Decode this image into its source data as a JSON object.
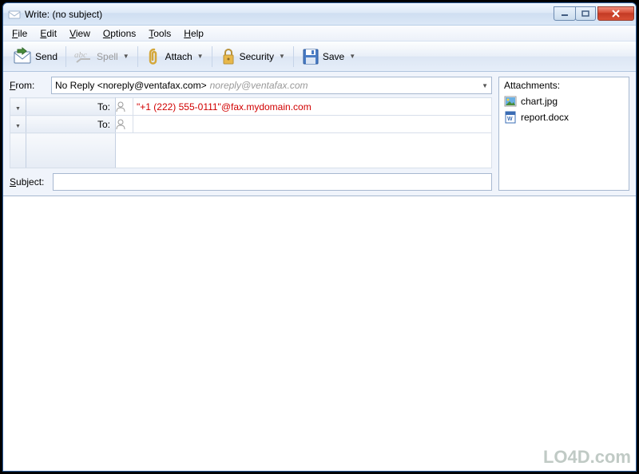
{
  "window": {
    "title": "Write: (no subject)"
  },
  "menu": {
    "file": "File",
    "edit": "Edit",
    "view": "View",
    "options": "Options",
    "tools": "Tools",
    "help": "Help"
  },
  "toolbar": {
    "send": "Send",
    "spell": "Spell",
    "attach": "Attach",
    "security": "Security",
    "save": "Save"
  },
  "compose": {
    "from_label": "From:",
    "from_name": "No Reply <noreply@ventafax.com>",
    "from_email": "noreply@ventafax.com",
    "recipients": [
      {
        "label": "To:",
        "value": "\"+1 (222) 555-0111\"@fax.mydomain.com",
        "invalid": true
      },
      {
        "label": "To:",
        "value": "",
        "invalid": false
      }
    ],
    "subject_label": "Subject:",
    "subject_value": ""
  },
  "attachments": {
    "header": "Attachments:",
    "items": [
      {
        "name": "chart.jpg",
        "icon": "image"
      },
      {
        "name": "report.docx",
        "icon": "word"
      }
    ]
  },
  "watermark": "LO4D.com"
}
